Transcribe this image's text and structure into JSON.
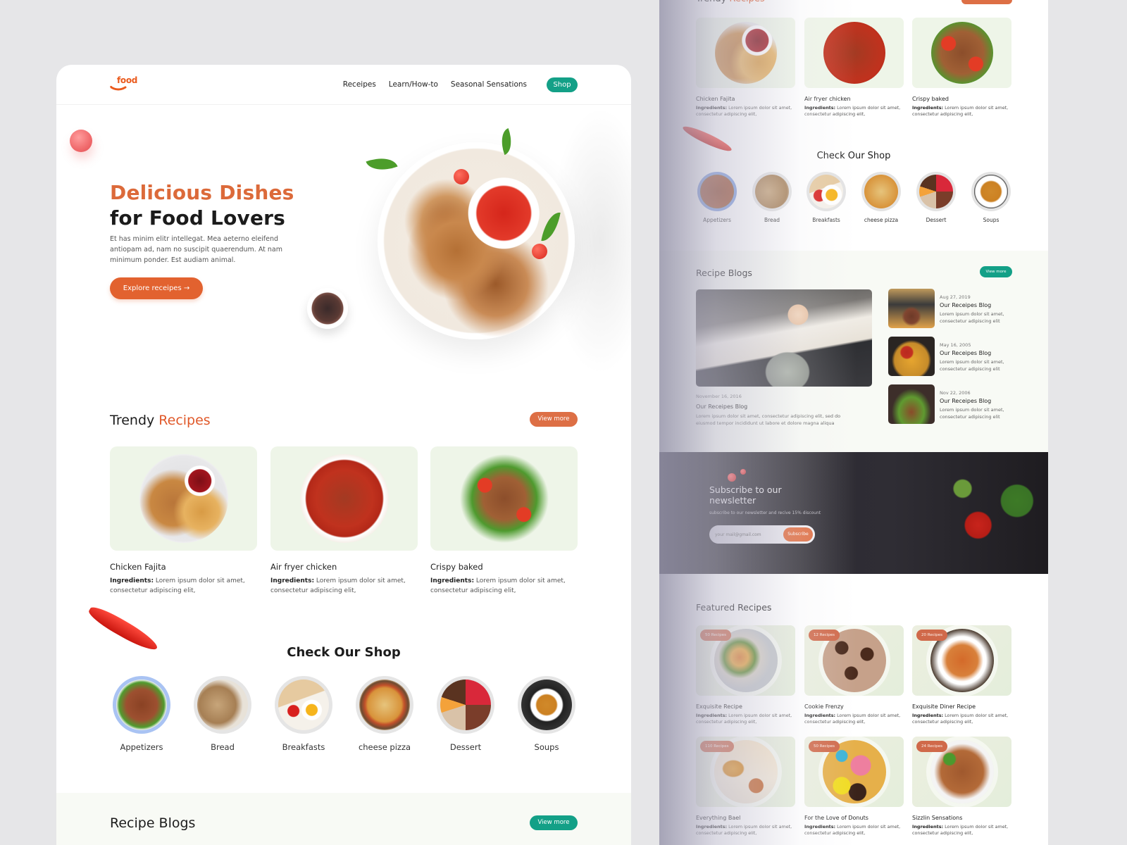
{
  "brand": {
    "logo_text": "food",
    "accent": "#e0592a",
    "teal": "#13a087"
  },
  "nav": {
    "links": [
      "Receipes",
      "Learn/How-to",
      "Seasonal Sensations"
    ],
    "shop_label": "Shop"
  },
  "hero": {
    "title_accent": "Delicious Dishes",
    "title_dark": "for Food Lovers",
    "description": "Et has minim elitr intellegat. Mea aeterno eleifend antiopam ad, nam no suscipit quaerendum. At nam minimum ponder. Est audiam animal.",
    "cta_label": "Explore receipes →"
  },
  "trendy": {
    "title_plain": "Trendy ",
    "title_accent": "Recipes",
    "view_more": "View more",
    "ingredients_label": "Ingredients:",
    "items": [
      {
        "name": "Chicken Fajita",
        "ingredients": "Lorem ipsum dolor sit amet, consectetur adipiscing elit,"
      },
      {
        "name": "Air fryer chicken",
        "ingredients": "Lorem ipsum dolor sit amet, consectetur adipiscing elit,"
      },
      {
        "name": "Crispy baked",
        "ingredients": "Lorem ipsum dolor sit amet, consectetur adipiscing elit,"
      }
    ]
  },
  "shop": {
    "title": "Check Our Shop",
    "categories": [
      "Appetizers",
      "Bread",
      "Breakfasts",
      "cheese pizza",
      "Dessert",
      "Soups"
    ],
    "selected": "Appetizers"
  },
  "blogs": {
    "title": "Recipe Blogs",
    "view_more": "View more",
    "main": {
      "date": "November 16, 2016",
      "title": "Our Receipes Blog",
      "description": "Lorem ipsum dolor sit amet, consectetur adipiscing elit, sed do eiusmod tempor incididunt ut labore et dolore magna aliqua"
    },
    "side": [
      {
        "date": "Aug 27, 2019",
        "title": "Our Receipes Blog",
        "description": "Lorem ipsum dolor sit amet, consectetur adipiscing elit"
      },
      {
        "date": "May 16, 2005",
        "title": "Our Receipes Blog",
        "description": "Lorem ipsum dolor sit amet, consectetur adipiscing elit"
      },
      {
        "date": "Nov 22, 2006",
        "title": "Our Receipes Blog",
        "description": "Lorem ipsum dolor sit amet, consectetur adipiscing elit"
      }
    ]
  },
  "newsletter": {
    "title": "Subscribe to our newsletter",
    "subtitle": "subscribe to our newsletter and recive 15% discount",
    "email_placeholder": "your mail@gmail.com",
    "button": "Subscribe"
  },
  "featured": {
    "title": "Featured Recipes",
    "ingredients_label": "Ingredients:",
    "items": [
      {
        "badge": "50 Recipes",
        "name": "Exquisite  Recipe",
        "ingredients": "Lorem ipsum dolor sit amet, consectetur adipiscing elit,"
      },
      {
        "badge": "12 Recipes",
        "name": "Cookie Frenzy",
        "ingredients": "Lorem ipsum dolor sit amet, consectetur adipiscing elit,"
      },
      {
        "badge": "20 Recipes",
        "name": "Exquisite Diner Recipe",
        "ingredients": "Lorem ipsum dolor sit amet, consectetur adipiscing elit,"
      },
      {
        "badge": "110 Recipes",
        "name": "Everything Bael",
        "ingredients": "Lorem ipsum dolor sit amet, consectetur adipiscing elit,"
      },
      {
        "badge": "50 Recipes",
        "name": "For the Love of Donuts",
        "ingredients": "Lorem ipsum dolor sit amet, consectetur adipiscing elit,"
      },
      {
        "badge": "24 Recipes",
        "name": "Sizzlin Sensations",
        "ingredients": "Lorem ipsum dolor sit amet, consectetur adipiscing elit,"
      }
    ]
  }
}
